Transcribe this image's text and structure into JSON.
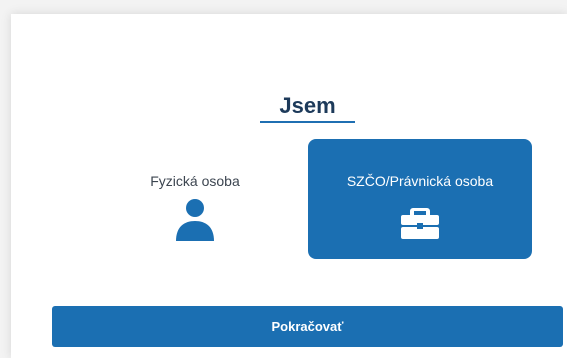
{
  "heading": "Jsem",
  "options": [
    {
      "label": "Fyzická osoba",
      "icon": "person-icon",
      "selected": false
    },
    {
      "label": "SZČO/Právnická osoba",
      "icon": "briefcase-icon",
      "selected": true
    }
  ],
  "continue_label": "Pokračovať",
  "colors": {
    "accent": "#1b6fb2",
    "heading_text": "#1d3a5a",
    "background": "#f3f3f3",
    "card": "#ffffff"
  }
}
